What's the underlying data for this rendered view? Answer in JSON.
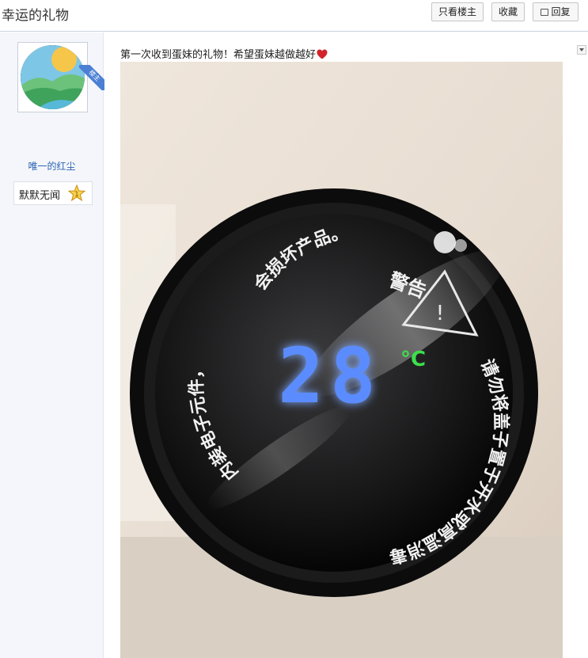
{
  "header": {
    "title": "幸运的礼物",
    "buttons": {
      "only_op": "只看楼主",
      "favorite": "收藏",
      "reply": "回复"
    }
  },
  "user": {
    "badge": "楼主",
    "name": "唯一的红尘",
    "level_title": "默默无闻",
    "level_number": "1"
  },
  "post": {
    "text": "第一次收到蛋妹的礼物！希望蛋妹越做越好",
    "photo": {
      "display_temp": "28",
      "display_unit": "°C",
      "ring_text_top": "会损坏产品。",
      "ring_text_left": "内装电子元件，",
      "ring_text_right": "请勿将盖子置于开水或高温消毒",
      "ring_text_warning": "警告"
    }
  },
  "colors": {
    "link": "#2d64b3",
    "ribbon": "#4a7fd4",
    "display_digits": "#5b8cff",
    "unit": "#3de04a"
  }
}
